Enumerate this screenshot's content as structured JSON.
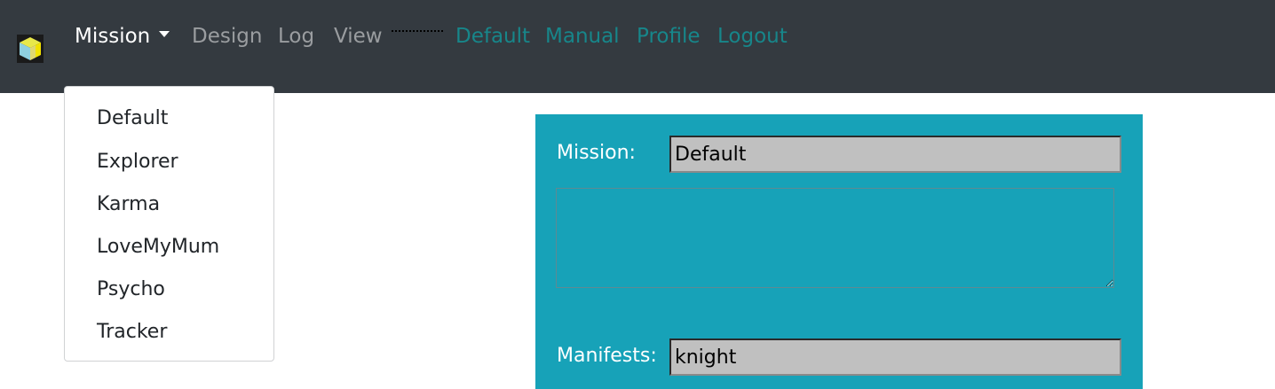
{
  "navbar": {
    "logo_icon": "cube-logo-icon",
    "items": [
      {
        "label": "Mission",
        "has_caret": true,
        "active": true
      },
      {
        "label": "Design"
      },
      {
        "label": "Log"
      },
      {
        "label": "View"
      }
    ],
    "links": [
      {
        "label": "Default"
      },
      {
        "label": "Manual"
      },
      {
        "label": "Profile"
      },
      {
        "label": "Logout"
      }
    ]
  },
  "dropdown": {
    "items": [
      "Default",
      "Explorer",
      "Karma",
      "LoveMyMum",
      "Psycho",
      "Tracker"
    ]
  },
  "panel": {
    "mission_label": "Mission:",
    "mission_value": "Default",
    "description_value": "",
    "manifests_label": "Manifests:",
    "manifests_value": "knight"
  },
  "colors": {
    "navbar_bg": "#343a40",
    "nav_active": "#ffffff",
    "nav_muted": "#9a9da0",
    "nav_link": "#17868a",
    "panel_bg": "#17a2b8",
    "input_bg": "#c0c0c0"
  }
}
